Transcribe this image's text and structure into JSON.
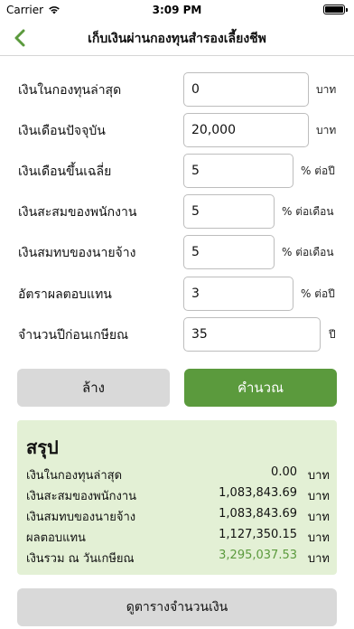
{
  "status": {
    "carrier": "Carrier",
    "time": "3:09 PM",
    "battery_level": 1.0
  },
  "nav": {
    "title": "เก็บเงินผ่านกองทุนสำรองเลี้ยงชีพ",
    "back_icon": "chevron-left-icon"
  },
  "form": {
    "rows": [
      {
        "label": "เงินในกองทุนล่าสุด",
        "value": "0",
        "unit": "บาท"
      },
      {
        "label": "เงินเดือนปัจจุบัน",
        "value": "20,000",
        "unit": "บาท"
      },
      {
        "label": "เงินเดือนขึ้นเฉลี่ย",
        "value": "5",
        "unit": "% ต่อปี"
      },
      {
        "label": "เงินสะสมของพนักงาน",
        "value": "5",
        "unit": "% ต่อเดือน"
      },
      {
        "label": "เงินสมทบของนายจ้าง",
        "value": "5",
        "unit": "% ต่อเดือน"
      },
      {
        "label": "อัตราผลตอบแทน",
        "value": "3",
        "unit": "% ต่อปี"
      },
      {
        "label": "จำนวนปีก่อนเกษียณ",
        "value": "35",
        "unit": "ปี"
      }
    ]
  },
  "buttons": {
    "clear": "ล้าง",
    "calculate": "คำนวณ",
    "view_table": "ดูตารางจำนวนเงิน"
  },
  "summary": {
    "title": "สรุป",
    "rows": [
      {
        "label": "เงินในกองทุนล่าสุด",
        "value": "0.00",
        "unit": "บาท"
      },
      {
        "label": "เงินสะสมของพนักงาน",
        "value": "1,083,843.69",
        "unit": "บาท"
      },
      {
        "label": "เงินสมทบของนายจ้าง",
        "value": "1,083,843.69",
        "unit": "บาท"
      },
      {
        "label": "ผลตอบแทน",
        "value": "1,127,350.15",
        "unit": "บาท"
      },
      {
        "label": "เงินรวม ณ วันเกษียณ",
        "value": "3,295,037.53",
        "unit": "บาท"
      }
    ]
  },
  "colors": {
    "accent": "#5b9a3d",
    "summary_bg": "#e3f0d5",
    "secondary_button": "#d9d9d9"
  }
}
